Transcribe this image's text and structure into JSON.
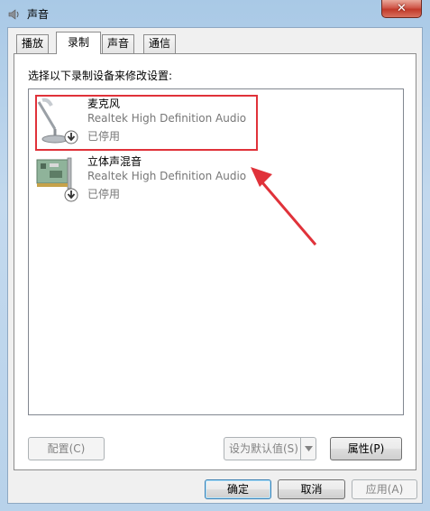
{
  "window": {
    "title": "声音",
    "icon": "speaker-icon",
    "close_icon": "close-icon",
    "close_symbol": "✕"
  },
  "tabs": [
    {
      "label": "播放",
      "active": false
    },
    {
      "label": "录制",
      "active": true
    },
    {
      "label": "声音",
      "active": false
    },
    {
      "label": "通信",
      "active": false
    }
  ],
  "panel": {
    "instruction": "选择以下录制设备来修改设置:",
    "devices": [
      {
        "name": "麦克风",
        "driver": "Realtek High Definition Audio",
        "status": "已停用",
        "icon": "microphone-icon",
        "badge_icon": "disabled-down-arrow-icon",
        "highlighted": true
      },
      {
        "name": "立体声混音",
        "driver": "Realtek High Definition Audio",
        "status": "已停用",
        "icon": "sound-card-icon",
        "badge_icon": "disabled-down-arrow-icon",
        "highlighted": false
      }
    ],
    "buttons": {
      "configure": "配置(C)",
      "set_default": "设为默认值(S)",
      "properties": "属性(P)"
    }
  },
  "footer": {
    "ok": "确定",
    "cancel": "取消",
    "apply": "应用(A)"
  },
  "annotation": {
    "highlight_color": "#e0323a",
    "arrow_color": "#e0323a"
  }
}
